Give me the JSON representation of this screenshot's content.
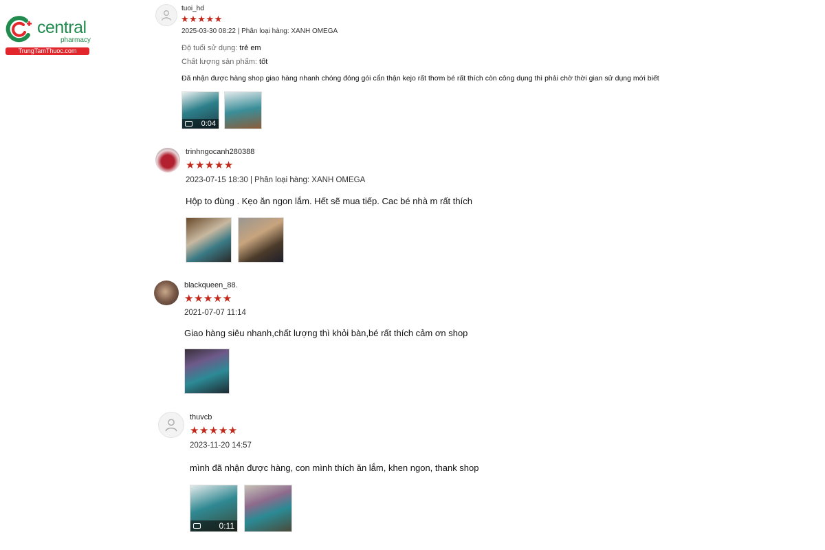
{
  "logo": {
    "name": "central",
    "sub": "pharmacy",
    "site": "TrungTamThuoc.com",
    "colors": {
      "green": "#1f8c4e",
      "red": "#e2262b"
    }
  },
  "star_color": "#c1271a",
  "reviews": [
    {
      "username": "tuoi_hd",
      "rating": 5,
      "stars": "★★★★★",
      "meta": "2025-03-30 08:22 | Phân loại hàng: XANH OMEGA",
      "fields": [
        {
          "label": "Độ tuổi sử dụng:",
          "value": "trẻ em"
        },
        {
          "label": "Chất lượng sản phẩm:",
          "value": "tốt"
        }
      ],
      "comment": "Đã nhận được hàng shop giao hàng nhanh chóng đóng gói cẩn thận kejo rất thơm bé rất thích còn công dụng thì phải chờ thời gian sử dụng mới biết",
      "media": [
        {
          "type": "video",
          "duration": "0:04"
        },
        {
          "type": "photo"
        }
      ]
    },
    {
      "username": "trinhngocanh280388",
      "rating": 5,
      "stars": "★★★★★",
      "meta": "2023-07-15 18:30 | Phân loại hàng: XANH OMEGA",
      "comment": "Hộp to đùng . Kẹo ăn ngon lắm. Hết sẽ mua tiếp. Cac bé nhà m rất thích",
      "media": [
        {
          "type": "photo"
        },
        {
          "type": "photo"
        }
      ]
    },
    {
      "username": "blackqueen_88.",
      "rating": 5,
      "stars": "★★★★★",
      "meta": "2021-07-07 11:14",
      "comment": "Giao hàng siêu nhanh,chất lượng thì khỏi bàn,bé rất thích cảm ơn shop",
      "media": [
        {
          "type": "photo"
        }
      ]
    },
    {
      "username": "thuvcb",
      "rating": 5,
      "stars": "★★★★★",
      "meta": "2023-11-20 14:57",
      "comment": "mình đã nhận được hàng, con mình thích ăn lắm, khen ngon, thank shop",
      "media": [
        {
          "type": "video",
          "duration": "0:11"
        },
        {
          "type": "photo"
        }
      ]
    }
  ]
}
